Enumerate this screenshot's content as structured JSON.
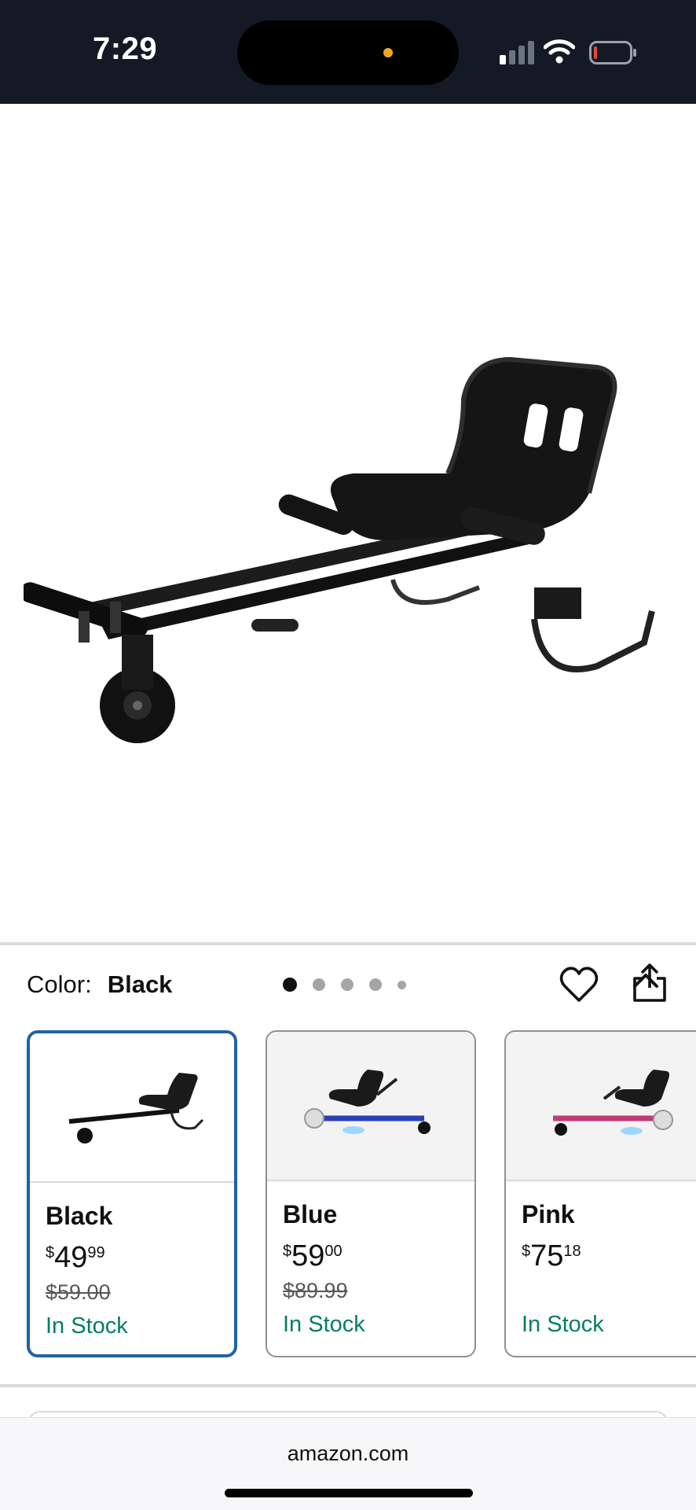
{
  "status_bar": {
    "time": "7:29",
    "icons": [
      "signal-icon",
      "wifi-icon",
      "battery-icon"
    ],
    "camera_indicator_color": "#f5a623"
  },
  "gallery": {
    "image_count": 5,
    "active_index": 0,
    "actions": [
      "heart-icon",
      "share-icon"
    ]
  },
  "color_selector": {
    "label": "Color:",
    "selected": "Black",
    "options": [
      {
        "name": "Black",
        "currency": "$",
        "whole": "49",
        "cents": "99",
        "list_price": "$59.00",
        "stock": "In Stock",
        "accent": "#1a1a1a"
      },
      {
        "name": "Blue",
        "currency": "$",
        "whole": "59",
        "cents": "00",
        "list_price": "$89.99",
        "stock": "In Stock",
        "accent": "#2a3fb8"
      },
      {
        "name": "Pink",
        "currency": "$",
        "whole": "75",
        "cents": "18",
        "list_price": "",
        "stock": "In Stock",
        "accent": "#c43a78"
      }
    ]
  },
  "browser": {
    "url": "amazon.com"
  },
  "colors": {
    "status_bar_bg": "#131a26",
    "selected_border": "#2162a1",
    "in_stock": "#067d62"
  }
}
